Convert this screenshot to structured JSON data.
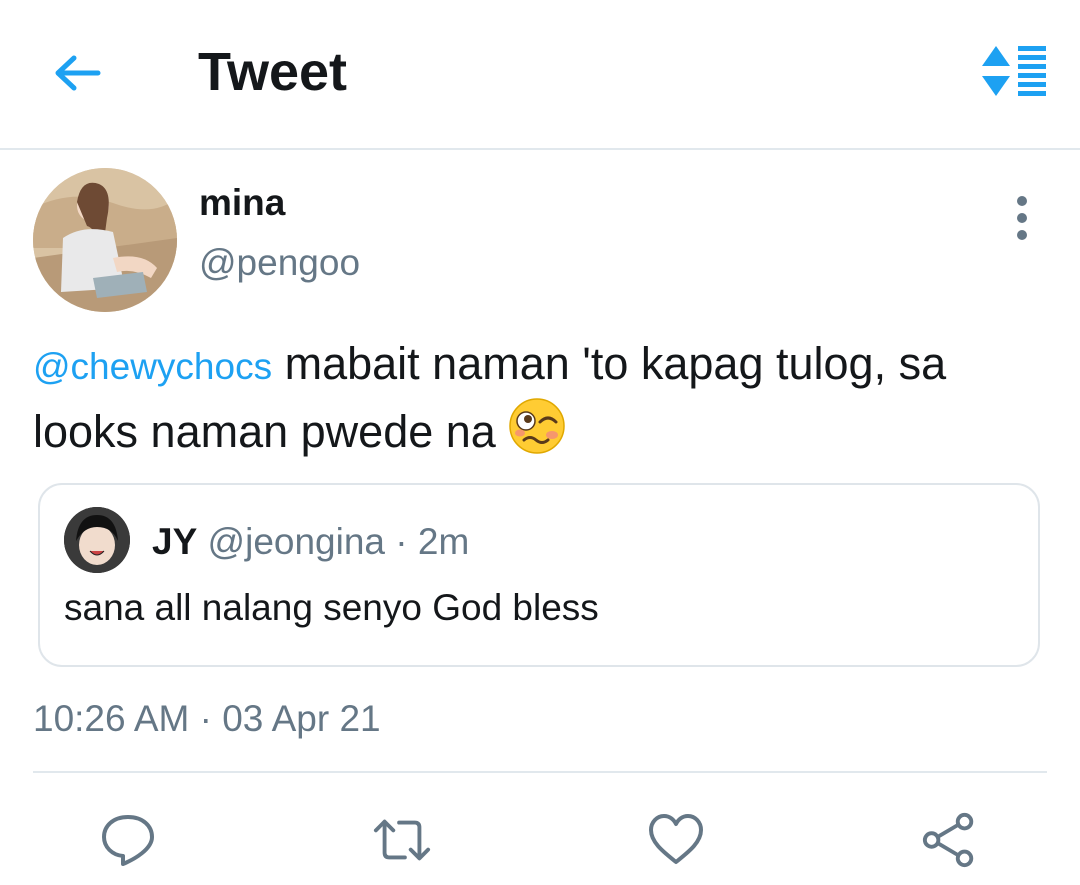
{
  "header": {
    "title": "Tweet",
    "back_icon": "arrow-left-icon",
    "sort_icon": "sort-toggle-icon",
    "accent_color": "#1da1f2"
  },
  "tweet": {
    "display_name": "mina",
    "handle": "@pengoo",
    "mention": "@chewychocs",
    "text": " mabait naman 'to kapag tulog, sa looks naman pwede na ",
    "emoji": "woozy-face",
    "timestamp": "10:26 AM · 03 Apr 21"
  },
  "quoted_tweet": {
    "display_name": "JY",
    "handle": "@jeongina",
    "time": "2m",
    "text": "sana all nalang senyo God bless"
  },
  "actions": [
    {
      "icon": "reply-icon"
    },
    {
      "icon": "retweet-icon"
    },
    {
      "icon": "like-icon"
    },
    {
      "icon": "share-icon"
    }
  ]
}
